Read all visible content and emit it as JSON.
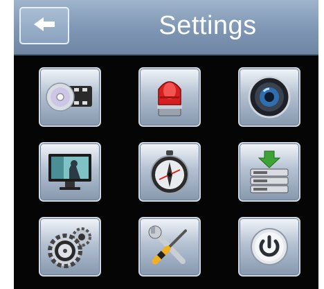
{
  "header": {
    "title": "Settings",
    "back_icon": "arrow-left-icon"
  },
  "grid": [
    {
      "icon": "dvd-video-icon"
    },
    {
      "icon": "alarm-light-icon"
    },
    {
      "icon": "camera-lens-icon"
    },
    {
      "icon": "monitor-display-icon"
    },
    {
      "icon": "compass-icon"
    },
    {
      "icon": "server-download-icon"
    },
    {
      "icon": "gear-disc-icon"
    },
    {
      "icon": "wrench-screwdriver-icon"
    },
    {
      "icon": "power-icon"
    }
  ],
  "colors": {
    "header": "#8aa2bf",
    "background": "#050505",
    "tile": "#b4c1d2"
  }
}
